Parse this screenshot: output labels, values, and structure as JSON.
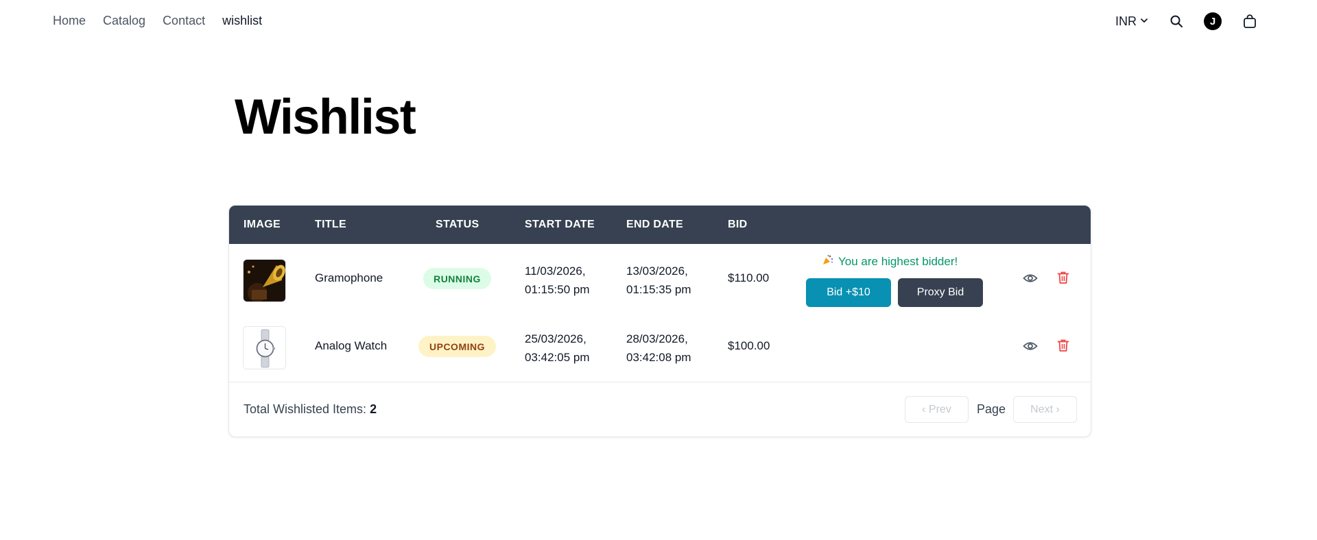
{
  "nav": {
    "links": [
      "Home",
      "Catalog",
      "Contact",
      "wishlist"
    ],
    "currency": "INR",
    "avatar_initial": "J"
  },
  "page": {
    "title": "Wishlist"
  },
  "table": {
    "headers": [
      "IMAGE",
      "TITLE",
      "STATUS",
      "START DATE",
      "END DATE",
      "BID"
    ],
    "rows": [
      {
        "title": "Gramophone",
        "status": "RUNNING",
        "start_date": "11/03/2026,",
        "start_time": "01:15:50 pm",
        "end_date": "13/03/2026,",
        "end_time": "01:15:35 pm",
        "bid": "$110.00",
        "highest_bidder_text": "You are highest bidder!",
        "bid_button": "Bid +$10",
        "proxy_button": "Proxy Bid",
        "image_icon": "gramophone-image"
      },
      {
        "title": "Analog Watch",
        "status": "UPCOMING",
        "start_date": "25/03/2026,",
        "start_time": "03:42:05 pm",
        "end_date": "28/03/2026,",
        "end_time": "03:42:08 pm",
        "bid": "$100.00",
        "image_icon": "watch-image"
      }
    ]
  },
  "footer": {
    "total_label": "Total Wishlisted Items:",
    "total_count": "2",
    "prev": "‹ Prev",
    "page_label": "Page",
    "next": "Next ›"
  },
  "colors": {
    "header_bg": "#374151",
    "bid_button": "#0891b2",
    "proxy_button": "#374151",
    "running_badge": "#dcfce7",
    "upcoming_badge": "#fef3c7",
    "highest_bidder_text": "#059669",
    "delete_icon": "#ef4444"
  }
}
